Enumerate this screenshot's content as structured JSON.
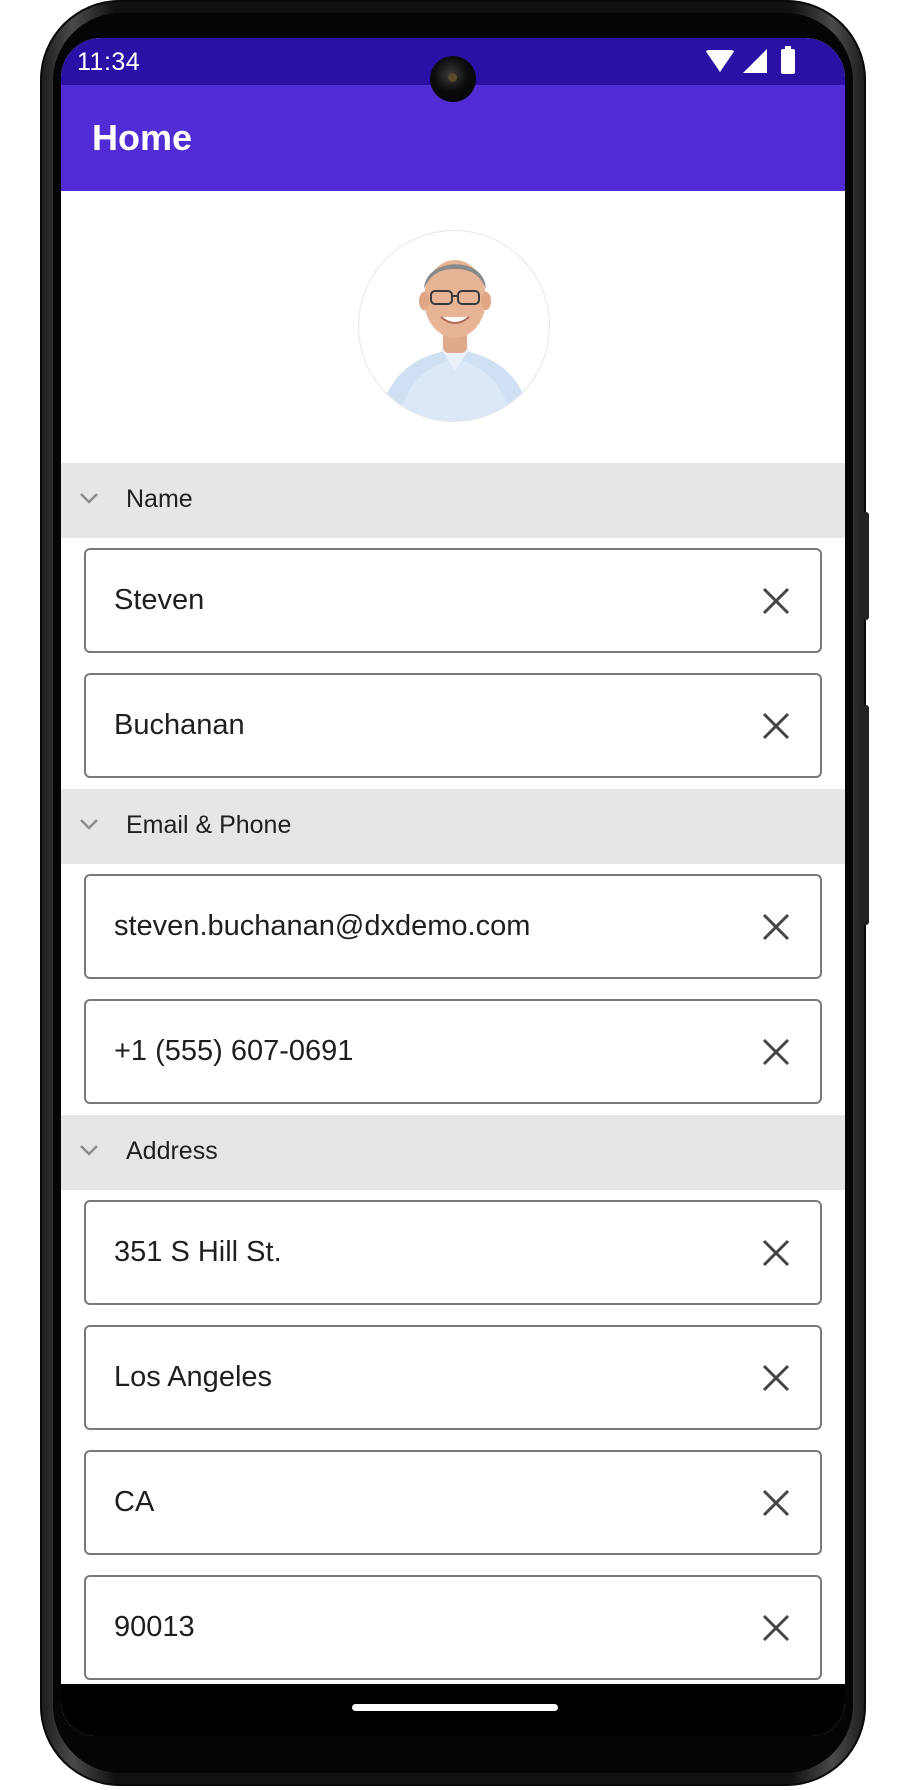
{
  "status_bar": {
    "time": "11:34",
    "icons": [
      "wifi-icon",
      "cell-signal-icon",
      "battery-icon"
    ],
    "color": "#2a10a5"
  },
  "app_bar": {
    "title": "Home",
    "color": "#512bd4"
  },
  "profile": {
    "avatar": "profile-photo"
  },
  "groups": [
    {
      "title": "Name",
      "fields": [
        {
          "value": "Steven"
        },
        {
          "value": "Buchanan"
        }
      ]
    },
    {
      "title": "Email & Phone",
      "fields": [
        {
          "value": "steven.buchanan@dxdemo.com"
        },
        {
          "value": "+1 (555) 607-0691"
        }
      ]
    },
    {
      "title": "Address",
      "fields": [
        {
          "value": "351 S Hill St."
        },
        {
          "value": "Los Angeles"
        },
        {
          "value": "CA"
        },
        {
          "value": "90013"
        }
      ]
    }
  ],
  "colors": {
    "group_header_bg": "#e6e6e6",
    "field_border": "#7a7a7a",
    "text": "#1f1f1f"
  }
}
